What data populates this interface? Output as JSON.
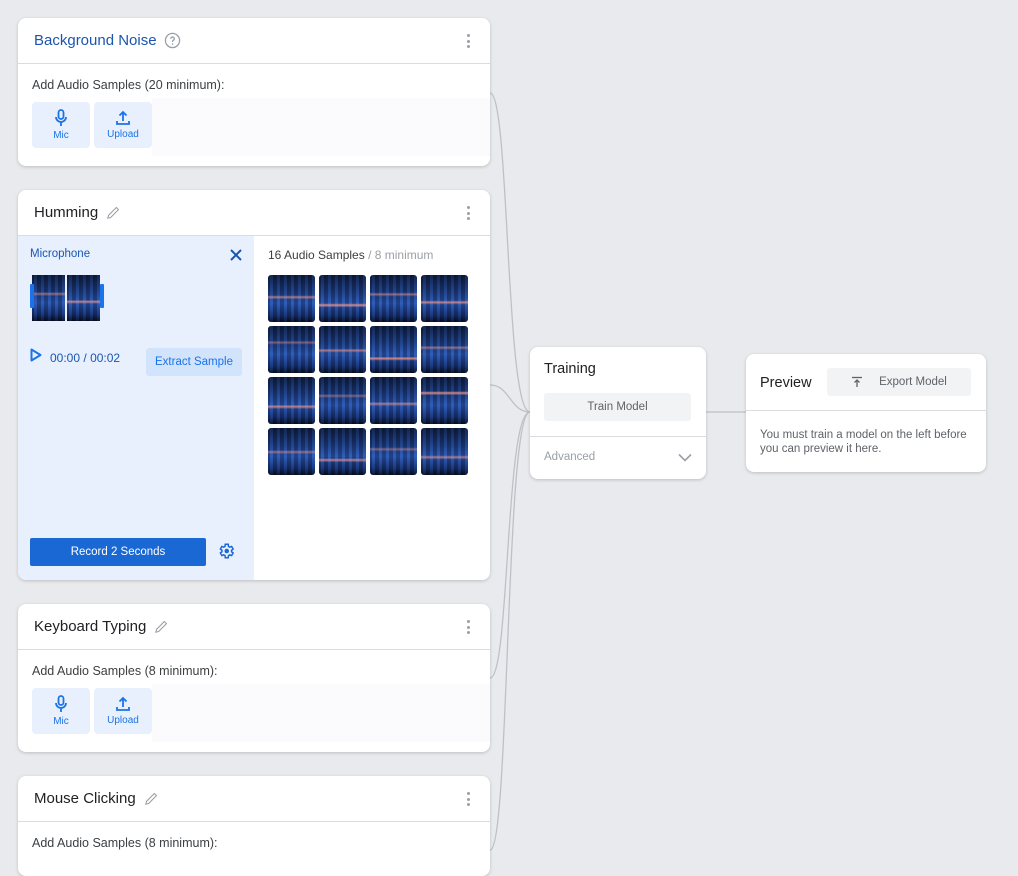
{
  "classes": [
    {
      "title": "Background Noise",
      "title_style": "blue",
      "header_icon": "help-circle-icon",
      "add_label": "Add Audio Samples (20 minimum):",
      "sources": [
        {
          "label": "Mic",
          "icon": "mic-icon"
        },
        {
          "label": "Upload",
          "icon": "upload-icon"
        }
      ]
    },
    {
      "title": "Humming",
      "header_icon": "edit-pencil-icon",
      "recorder": {
        "title": "Microphone",
        "time_current": "00:00",
        "time_separator": "/",
        "time_total": "00:02",
        "extract_label": "Extract Sample",
        "record_label": "Record 2 Seconds"
      },
      "samples": {
        "count_label": "16 Audio Samples",
        "minimum_label": " / 8 minimum",
        "count": 16
      }
    },
    {
      "title": "Keyboard Typing",
      "header_icon": "edit-pencil-icon",
      "add_label": "Add Audio Samples (8 minimum):",
      "sources": [
        {
          "label": "Mic",
          "icon": "mic-icon"
        },
        {
          "label": "Upload",
          "icon": "upload-icon"
        }
      ]
    },
    {
      "title": "Mouse Clicking",
      "header_icon": "edit-pencil-icon",
      "add_label": "Add Audio Samples (8 minimum):"
    }
  ],
  "training": {
    "title": "Training",
    "train_button": "Train Model",
    "advanced_label": "Advanced"
  },
  "preview": {
    "title": "Preview",
    "export_button": "Export Model",
    "message": "You must train a model on the left before you can preview it here."
  },
  "colors": {
    "accent": "#1a73e8",
    "accent_dark": "#1a56b0",
    "background": "#e8eaed",
    "panel_blue": "#e8f0fe"
  }
}
